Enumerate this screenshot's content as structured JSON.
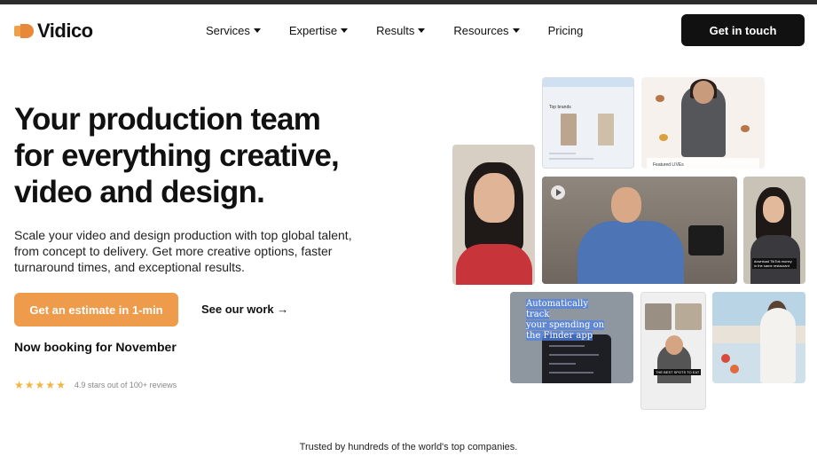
{
  "header": {
    "brand": "Vidico",
    "nav": [
      {
        "label": "Services",
        "has_dropdown": true
      },
      {
        "label": "Expertise",
        "has_dropdown": true
      },
      {
        "label": "Results",
        "has_dropdown": true
      },
      {
        "label": "Resources",
        "has_dropdown": true
      },
      {
        "label": "Pricing",
        "has_dropdown": false
      }
    ],
    "cta": "Get in touch"
  },
  "hero": {
    "headline_lines": [
      "Your production team",
      "for everything creative,",
      "video and design."
    ],
    "subtext": "Scale your video and design production with top global talent, from concept to delivery. Get more creative options, faster turnaround times, and exceptional results.",
    "primary_button": "Get an estimate in 1-min",
    "secondary_link": "See our work →",
    "booking": "Now booking for November",
    "rating": {
      "stars": 5,
      "text": "4.9 stars out of 100+ reviews"
    }
  },
  "collage": {
    "tile1_label": "Top brands",
    "tile2_label": "Featured LIVEs",
    "tile6_caption_lines": [
      "Automatically track",
      "your spending on",
      "the Finder app"
    ],
    "tile5_caption": "download TikTok money in the same restaurant",
    "tile7_caption": "THE BEST SPOTS TO EAT"
  },
  "footer": {
    "trusted": "Trusted by hundreds of the world's top companies."
  },
  "colors": {
    "accent": "#ee9b4c",
    "dark": "#111111",
    "star": "#f2b542"
  }
}
